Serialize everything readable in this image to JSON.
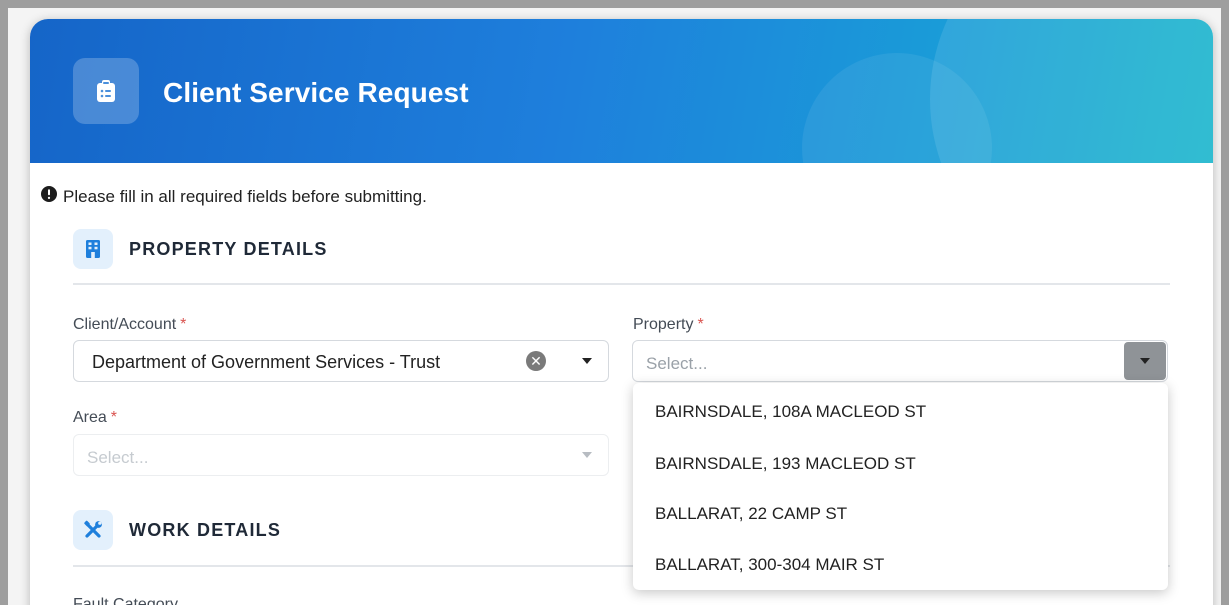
{
  "header": {
    "title": "Client Service Request",
    "icon": "clipboard-list-icon"
  },
  "notice": {
    "text": "Please fill in all required fields before submitting.",
    "icon": "exclamation-circle-icon"
  },
  "sections": {
    "property": {
      "title": "PROPERTY DETAILS",
      "icon": "building-icon"
    },
    "work": {
      "title": "WORK DETAILS",
      "icon": "tools-icon"
    }
  },
  "fields": {
    "client": {
      "label": "Client/Account",
      "required_mark": "*",
      "value": "Department of Government Services - Trust"
    },
    "property": {
      "label": "Property",
      "required_mark": "*",
      "placeholder": "Select..."
    },
    "area": {
      "label": "Area",
      "required_mark": "*",
      "placeholder": "Select..."
    },
    "fault_category": {
      "label": "Fault Category"
    }
  },
  "property_options": [
    "BAIRNSDALE, 108A MACLEOD ST",
    "BAIRNSDALE, 193 MACLEOD ST",
    "BALLARAT, 22 CAMP ST",
    "BALLARAT, 300-304 MAIR ST"
  ],
  "colors": {
    "header_start": "#1565c8",
    "header_end": "#1ab6cc",
    "required": "#d9534f",
    "section_icon": "#1e7fdc"
  }
}
